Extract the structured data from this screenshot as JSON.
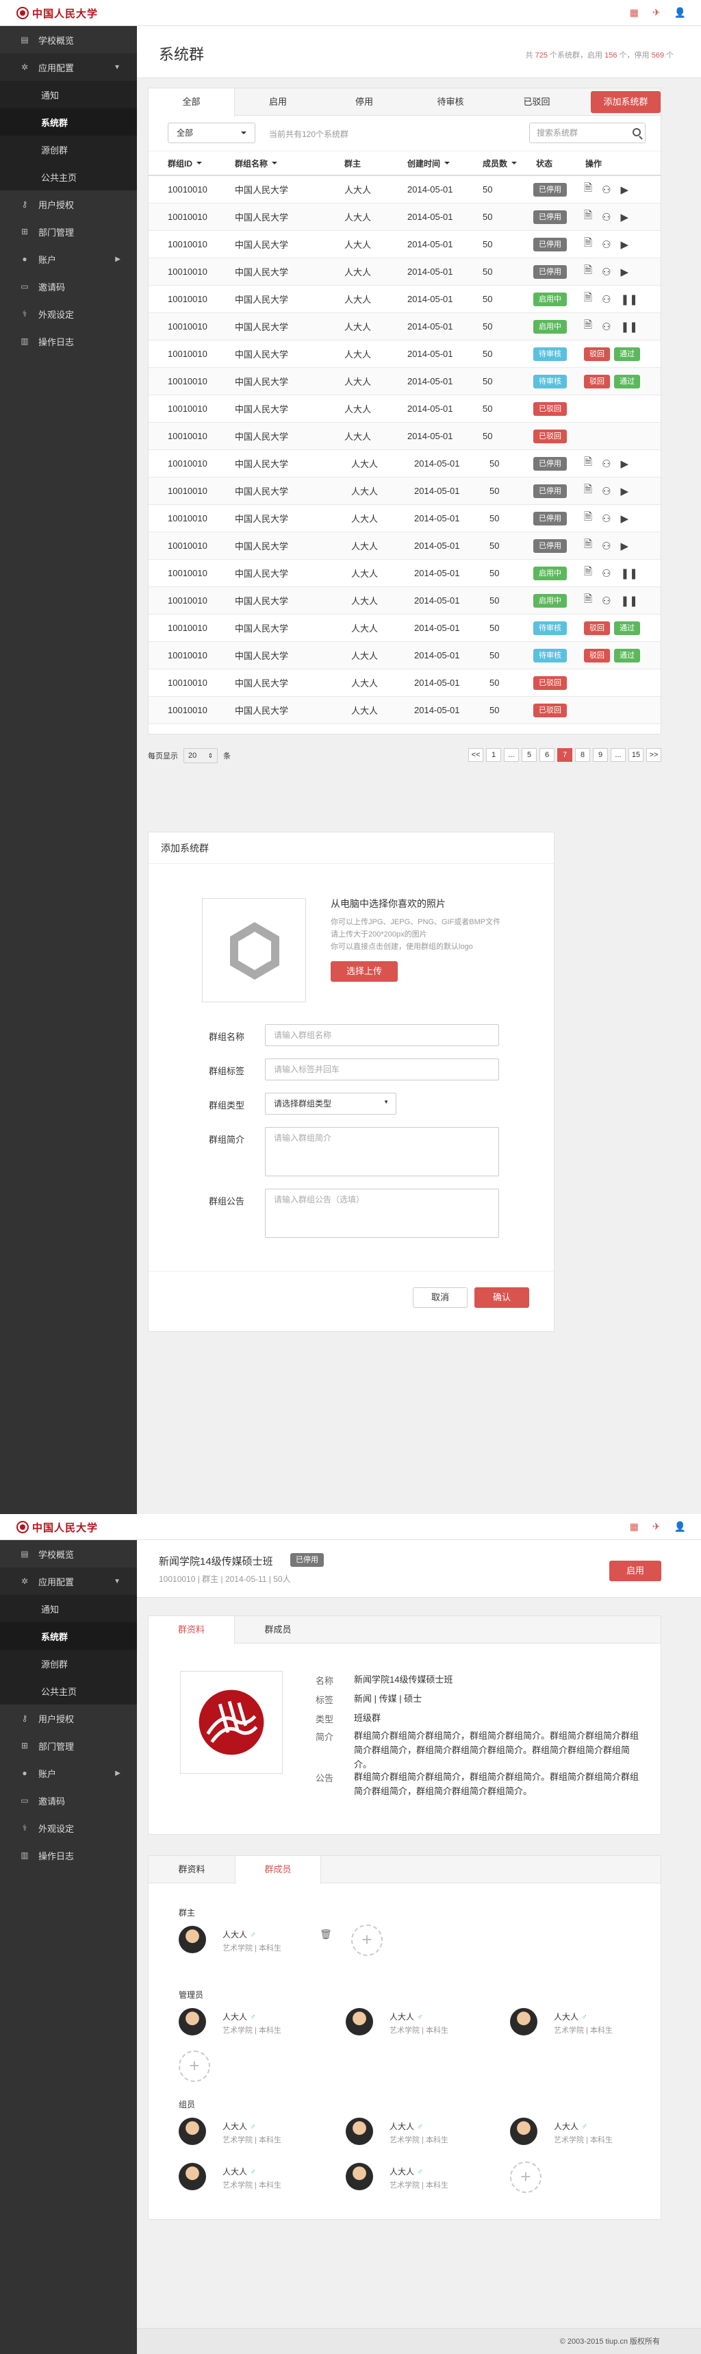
{
  "brand": {
    "name": "中国人民大学"
  },
  "sidebar": {
    "items": [
      {
        "label": "学校概览",
        "icon": "dashboard-icon"
      },
      {
        "label": "应用配置",
        "icon": "gears-icon"
      },
      {
        "label": "用户授权",
        "icon": "key-icon"
      },
      {
        "label": "部门管理",
        "icon": "sitemap-icon"
      },
      {
        "label": "账户",
        "icon": "user-icon"
      },
      {
        "label": "邀请码",
        "icon": "ticket-icon"
      },
      {
        "label": "外观设定",
        "icon": "brush-icon"
      },
      {
        "label": "操作日志",
        "icon": "log-icon"
      }
    ],
    "subitems": [
      {
        "label": "通知"
      },
      {
        "label": "系统群"
      },
      {
        "label": "源创群"
      },
      {
        "label": "公共主页"
      }
    ]
  },
  "page1": {
    "title": "系统群",
    "stats": {
      "prefix": "共",
      "total": "725",
      "t1": "个系统群，启用",
      "active": "156",
      "t2": "个，停用",
      "disabled": "569",
      "t3": "个"
    },
    "tabs": [
      "全部",
      "启用",
      "停用",
      "待审核",
      "已驳回"
    ],
    "add_button": "添加系统群",
    "filter": {
      "select": "全部",
      "text": "当前共有120个系统群",
      "search_placeholder": "搜索系统群"
    },
    "columns": [
      "群组ID",
      "群组名称",
      "群主",
      "创建时间",
      "成员数",
      "状态",
      "操作"
    ],
    "rows": [
      {
        "id": "10010010",
        "name": "中国人民大学",
        "owner": "人大人",
        "date": "2014-05-01",
        "members": "50",
        "status": "已停用",
        "type": "gray",
        "ops": "play"
      },
      {
        "id": "10010010",
        "name": "中国人民大学",
        "owner": "人大人",
        "date": "2014-05-01",
        "members": "50",
        "status": "已停用",
        "type": "gray",
        "ops": "play"
      },
      {
        "id": "10010010",
        "name": "中国人民大学",
        "owner": "人大人",
        "date": "2014-05-01",
        "members": "50",
        "status": "已停用",
        "type": "gray",
        "ops": "play"
      },
      {
        "id": "10010010",
        "name": "中国人民大学",
        "owner": "人大人",
        "date": "2014-05-01",
        "members": "50",
        "status": "已停用",
        "type": "gray",
        "ops": "play"
      },
      {
        "id": "10010010",
        "name": "中国人民大学",
        "owner": "人大人",
        "date": "2014-05-01",
        "members": "50",
        "status": "启用中",
        "type": "green",
        "ops": "pause"
      },
      {
        "id": "10010010",
        "name": "中国人民大学",
        "owner": "人大人",
        "date": "2014-05-01",
        "members": "50",
        "status": "启用中",
        "type": "green",
        "ops": "pause"
      },
      {
        "id": "10010010",
        "name": "中国人民大学",
        "owner": "人大人",
        "date": "2014-05-01",
        "members": "50",
        "status": "待审核",
        "type": "blue",
        "ops": "review"
      },
      {
        "id": "10010010",
        "name": "中国人民大学",
        "owner": "人大人",
        "date": "2014-05-01",
        "members": "50",
        "status": "待审核",
        "type": "blue",
        "ops": "review"
      },
      {
        "id": "10010010",
        "name": "中国人民大学",
        "owner": "人大人",
        "date": "2014-05-01",
        "members": "50",
        "status": "已驳回",
        "type": "red",
        "ops": "none"
      },
      {
        "id": "10010010",
        "name": "中国人民大学",
        "owner": "人大人",
        "date": "2014-05-01",
        "members": "50",
        "status": "已驳回",
        "type": "red",
        "ops": "none"
      },
      {
        "id": "10010010",
        "name": "中国人民大学",
        "owner": "人大人",
        "date": "2014-05-01",
        "members": "50",
        "status": "已停用",
        "type": "gray",
        "ops": "play"
      },
      {
        "id": "10010010",
        "name": "中国人民大学",
        "owner": "人大人",
        "date": "2014-05-01",
        "members": "50",
        "status": "已停用",
        "type": "gray",
        "ops": "play"
      },
      {
        "id": "10010010",
        "name": "中国人民大学",
        "owner": "人大人",
        "date": "2014-05-01",
        "members": "50",
        "status": "已停用",
        "type": "gray",
        "ops": "play"
      },
      {
        "id": "10010010",
        "name": "中国人民大学",
        "owner": "人大人",
        "date": "2014-05-01",
        "members": "50",
        "status": "已停用",
        "type": "gray",
        "ops": "play"
      },
      {
        "id": "10010010",
        "name": "中国人民大学",
        "owner": "人大人",
        "date": "2014-05-01",
        "members": "50",
        "status": "启用中",
        "type": "green",
        "ops": "pause"
      },
      {
        "id": "10010010",
        "name": "中国人民大学",
        "owner": "人大人",
        "date": "2014-05-01",
        "members": "50",
        "status": "启用中",
        "type": "green",
        "ops": "pause"
      },
      {
        "id": "10010010",
        "name": "中国人民大学",
        "owner": "人大人",
        "date": "2014-05-01",
        "members": "50",
        "status": "待审核",
        "type": "blue",
        "ops": "review"
      },
      {
        "id": "10010010",
        "name": "中国人民大学",
        "owner": "人大人",
        "date": "2014-05-01",
        "members": "50",
        "status": "待审核",
        "type": "blue",
        "ops": "review"
      },
      {
        "id": "10010010",
        "name": "中国人民大学",
        "owner": "人大人",
        "date": "2014-05-01",
        "members": "50",
        "status": "已驳回",
        "type": "red",
        "ops": "none"
      },
      {
        "id": "10010010",
        "name": "中国人民大学",
        "owner": "人大人",
        "date": "2014-05-01",
        "members": "50",
        "status": "已驳回",
        "type": "red",
        "ops": "none"
      }
    ],
    "review_labels": {
      "reject": "驳回",
      "approve": "通过"
    },
    "pagination": {
      "per_page_label": "每页显示",
      "per_page": "20",
      "unit": "条",
      "pages": [
        "<<",
        "1",
        "...",
        "5",
        "6",
        "7",
        "8",
        "9",
        "...",
        "15",
        ">>"
      ],
      "current": "7"
    }
  },
  "add_form": {
    "title": "添加系统群",
    "upload": {
      "heading": "从电脑中选择你喜欢的照片",
      "line1": "你可以上传JPG、JEPG、PNG、GIF或者BMP文件",
      "line2": "请上传大于200*200px的图片",
      "line3": "你可以直接点击创建，使用群组的默认logo",
      "button": "选择上传"
    },
    "fields": [
      {
        "label": "群组名称",
        "placeholder": "请输入群组名称"
      },
      {
        "label": "群组标签",
        "placeholder": "请输入标签并回车"
      },
      {
        "label": "群组类型",
        "placeholder": "请选择群组类型"
      },
      {
        "label": "群组简介",
        "placeholder": "请输入群组简介"
      },
      {
        "label": "群组公告",
        "placeholder": "请输入群组公告（选填）"
      }
    ],
    "cancel": "取消",
    "confirm": "确认"
  },
  "page2": {
    "title": "新闻学院14级传媒硕士班",
    "status_badge": "已停用",
    "subtitle": "10010010 | 群主 | 2014-05-11 | 50人",
    "enable_button": "启用",
    "tabs1": [
      "群资料",
      "群成员"
    ],
    "details": [
      {
        "label": "名称",
        "value": "新闻学院14级传媒硕士班"
      },
      {
        "label": "标签",
        "value": "新闻 | 传媒 | 硕士"
      },
      {
        "label": "类型",
        "value": "班级群"
      },
      {
        "label": "简介",
        "value": "群组简介群组简介群组简介，群组简介群组简介。群组简介群组简介群组简介群组简介，群组简介群组简介群组简介。群组简介群组简介群组简介。"
      },
      {
        "label": "公告",
        "value": "群组简介群组简介群组简介，群组简介群组简介。群组简介群组简介群组简介群组简介，群组简介群组简介群组简介。"
      }
    ],
    "tabs2": [
      "群资料",
      "群成员"
    ],
    "owner_label": "群主",
    "admin_label": "管理员",
    "member_label": "组员",
    "member_name": "人大人",
    "member_sub": "艺术学院 | 本科生"
  },
  "footer": {
    "text": "© 2003-2015 tiup.cn 版权所有"
  },
  "colors": {
    "accent": "#d9534f",
    "sidebar": "#333333",
    "gray": "#777777",
    "green": "#5cb85c",
    "blue": "#5bc0de"
  }
}
